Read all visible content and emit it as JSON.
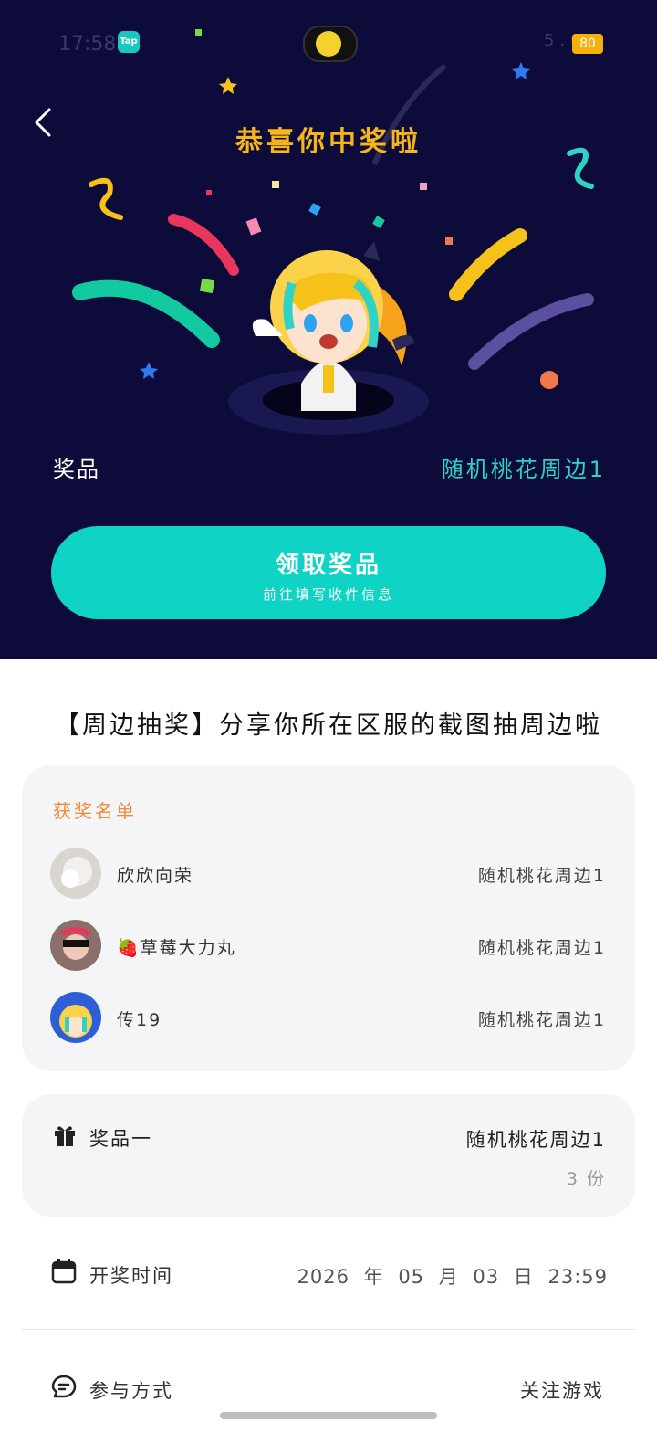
{
  "status_bar": {
    "time": "17:58",
    "app_badge": "Tap",
    "net_speed": "5.00",
    "battery": "80"
  },
  "hero": {
    "back_icon": "chevron-left-icon",
    "congrats": "恭喜你中奖啦",
    "prize_label": "奖品",
    "prize_value": "随机桃花周边1",
    "claim_button": "领取奖品",
    "claim_hint": "前往填写收件信息"
  },
  "event_title": "【周边抽奖】分享你所在区服的截图抽周边啦",
  "winners": {
    "heading": "获奖名单",
    "list": [
      {
        "name": "欣欣向荣",
        "prize": "随机桃花周边1"
      },
      {
        "name": "🍓草莓大力丸",
        "prize": "随机桃花周边1"
      },
      {
        "name": "传19",
        "prize": "随机桃花周边1"
      }
    ]
  },
  "prize_info": {
    "label": "奖品一",
    "value": "随机桃花周边1",
    "quantity": "3 份"
  },
  "draw_time": {
    "label": "开奖时间",
    "value": "2026 年 05 月 03 日 23:59"
  },
  "participation": {
    "label": "参与方式",
    "action": "关注游戏"
  },
  "colors": {
    "hero_bg": "#0d0b3a",
    "accent_teal": "#0fd3c4",
    "heading_gold": "#f6b51a",
    "winner_heading": "#f58a3a"
  }
}
